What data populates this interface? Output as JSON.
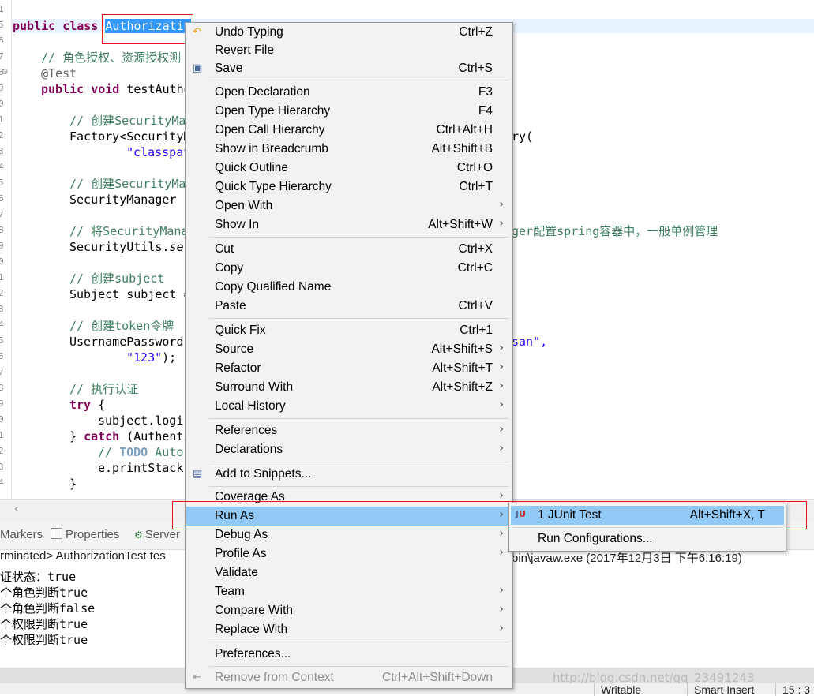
{
  "editor": {
    "line_numbers": [
      "1",
      "5",
      "6",
      "7",
      "8",
      "9",
      "0",
      "1",
      "2",
      "3",
      "4",
      "5",
      "6",
      "7",
      "8",
      "9",
      "0",
      "1",
      "2",
      "3",
      "4",
      "5",
      "6",
      "7",
      "8",
      "9",
      "0",
      "1",
      "2",
      "3",
      "4"
    ],
    "class_kw": "public class",
    "class_name": "Authorizatio",
    "comment_auth": "// 角色授权、资源授权测",
    "annotation": "@Test",
    "method_sig_kw": "public void",
    "method_name": "testAutho",
    "c_create_sm1": "// 创建SecurityMa",
    "factory_line": "Factory<SecurityM",
    "factory_tail": "ry(",
    "classpath_str": "\"classpat",
    "c_create_sm2": "// 创建SecurityMa",
    "sm_line": "SecurityManager s",
    "c_set_sm": "// 将SecurityMana",
    "c_set_sm_tail": "ger配置spring容器中，一般单例管理",
    "utils_line": "SecurityUtils.",
    "utils_method": "se",
    "c_subject": "// 创建subject",
    "subject_line": "Subject subject =",
    "c_token": "// 创建token令牌",
    "token_line": "UsernamePassword",
    "token_tail": "san\",",
    "pwd_str": "\"123\"",
    "pwd_end": ");",
    "c_auth": "// 执行认证",
    "try_kw": "try",
    "try_brace": " {",
    "login_line": "subject.logi",
    "catch_close": "} ",
    "catch_kw": "catch",
    "catch_tail": " (Authenti",
    "todo_prefix": "// ",
    "todo_word": "TODO",
    "todo_tail": " Auto-",
    "print_line": "e.printStack",
    "close_brace": "}"
  },
  "panel": {
    "tab_markers": "Markers",
    "tab_properties": "Properties",
    "tab_servers": "Server",
    "console_left": "rminated> AuthorizationTest.tes",
    "console_right": "bin\\javaw.exe (2017年12月3日 下午6:16:19)",
    "console_lines": [
      "证状态：true",
      "个角色判断true",
      "个角色判断false",
      "个权限判断true",
      "个权限判断true"
    ]
  },
  "status": {
    "writable": "Writable",
    "insert_mode": "Smart Insert",
    "position": "15 : 3"
  },
  "watermark": "http://blog.csdn.net/qq_23491243",
  "menu": {
    "undo": {
      "label": "Undo Typing",
      "shortcut": "Ctrl+Z"
    },
    "revert": {
      "label": "Revert File"
    },
    "save": {
      "label": "Save",
      "shortcut": "Ctrl+S"
    },
    "open_decl": {
      "label": "Open Declaration",
      "shortcut": "F3"
    },
    "open_type": {
      "label": "Open Type Hierarchy",
      "shortcut": "F4"
    },
    "open_call": {
      "label": "Open Call Hierarchy",
      "shortcut": "Ctrl+Alt+H"
    },
    "breadcrumb": {
      "label": "Show in Breadcrumb",
      "shortcut": "Alt+Shift+B"
    },
    "quick_outline": {
      "label": "Quick Outline",
      "shortcut": "Ctrl+O"
    },
    "quick_type": {
      "label": "Quick Type Hierarchy",
      "shortcut": "Ctrl+T"
    },
    "open_with": {
      "label": "Open With"
    },
    "show_in": {
      "label": "Show In",
      "shortcut": "Alt+Shift+W"
    },
    "cut": {
      "label": "Cut",
      "shortcut": "Ctrl+X"
    },
    "copy": {
      "label": "Copy",
      "shortcut": "Ctrl+C"
    },
    "copy_qualified": {
      "label": "Copy Qualified Name"
    },
    "paste": {
      "label": "Paste",
      "shortcut": "Ctrl+V"
    },
    "quick_fix": {
      "label": "Quick Fix",
      "shortcut": "Ctrl+1"
    },
    "source": {
      "label": "Source",
      "shortcut": "Alt+Shift+S"
    },
    "refactor": {
      "label": "Refactor",
      "shortcut": "Alt+Shift+T"
    },
    "surround": {
      "label": "Surround With",
      "shortcut": "Alt+Shift+Z"
    },
    "local_history": {
      "label": "Local History"
    },
    "references": {
      "label": "References"
    },
    "declarations": {
      "label": "Declarations"
    },
    "add_snippets": {
      "label": "Add to Snippets..."
    },
    "coverage_as": {
      "label": "Coverage As"
    },
    "run_as": {
      "label": "Run As"
    },
    "debug_as": {
      "label": "Debug As"
    },
    "profile_as": {
      "label": "Profile As"
    },
    "validate": {
      "label": "Validate"
    },
    "team": {
      "label": "Team"
    },
    "compare_with": {
      "label": "Compare With"
    },
    "replace_with": {
      "label": "Replace With"
    },
    "preferences": {
      "label": "Preferences..."
    },
    "remove_context": {
      "label": "Remove from Context",
      "shortcut": "Ctrl+Alt+Shift+Down"
    }
  },
  "submenu": {
    "junit": {
      "label": "1 JUnit Test",
      "shortcut": "Alt+Shift+X, T"
    },
    "run_configs": {
      "label": "Run Configurations..."
    }
  },
  "colors": {
    "hover": "#91c9f7",
    "selection": "#3399ff",
    "highlight_box": "#e8151b",
    "keyword": "#7f0055",
    "comment": "#3f7f5f",
    "string": "#2a00ff"
  }
}
